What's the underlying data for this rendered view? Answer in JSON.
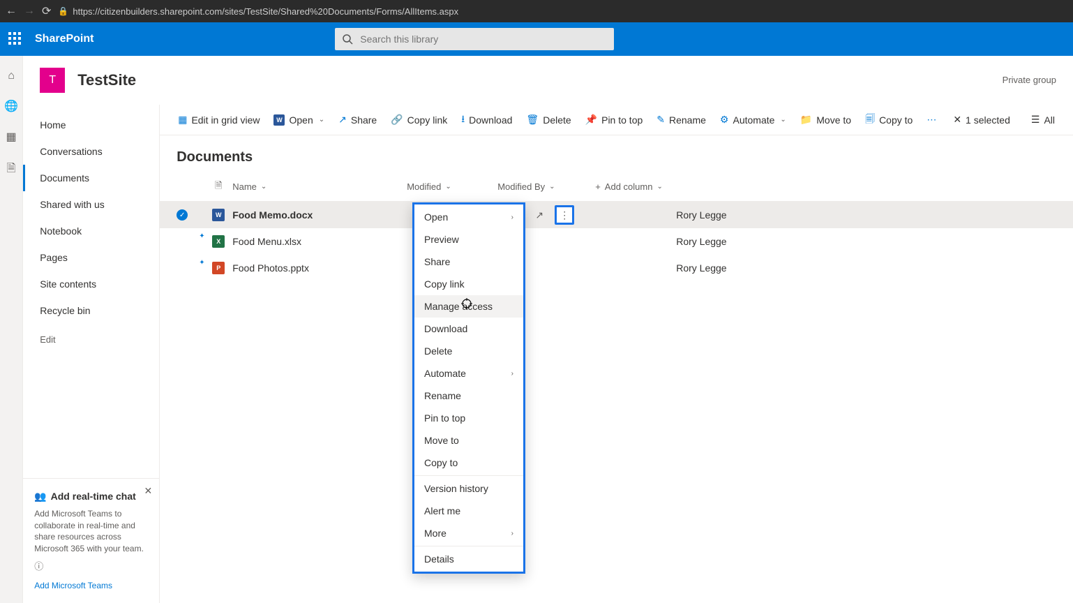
{
  "browser": {
    "url": "https://citizenbuilders.sharepoint.com/sites/TestSite/Shared%20Documents/Forms/AllItems.aspx"
  },
  "suite": {
    "app_name": "SharePoint",
    "search_placeholder": "Search this library"
  },
  "site": {
    "logo_letter": "T",
    "title": "TestSite",
    "privacy": "Private group"
  },
  "left_nav": {
    "items": [
      "Home",
      "Conversations",
      "Documents",
      "Shared with us",
      "Notebook",
      "Pages",
      "Site contents",
      "Recycle bin"
    ],
    "edit": "Edit"
  },
  "teams_promo": {
    "title": "Add real-time chat",
    "body": "Add Microsoft Teams to collaborate in real-time and share resources across Microsoft 365 with your team.",
    "link": "Add Microsoft Teams"
  },
  "cmdbar": {
    "edit_grid": "Edit in grid view",
    "open": "Open",
    "share": "Share",
    "copy_link": "Copy link",
    "download": "Download",
    "delete": "Delete",
    "pin": "Pin to top",
    "rename": "Rename",
    "automate": "Automate",
    "move_to": "Move to",
    "copy_to": "Copy to",
    "selected": "1 selected",
    "all": "All"
  },
  "list": {
    "title": "Documents",
    "columns": {
      "name": "Name",
      "modified": "Modified",
      "modified_by": "Modified By",
      "add": "Add column"
    },
    "rows": [
      {
        "name": "Food Memo.docx",
        "type": "word",
        "modified_by": "Rory Legge",
        "selected": true,
        "new": false
      },
      {
        "name": "Food Menu.xlsx",
        "type": "excel",
        "modified_by": "Rory Legge",
        "selected": false,
        "new": true
      },
      {
        "name": "Food Photos.pptx",
        "type": "ppt",
        "modified_by": "Rory Legge",
        "selected": false,
        "new": true
      }
    ]
  },
  "context_menu": {
    "open": "Open",
    "preview": "Preview",
    "share": "Share",
    "copy_link": "Copy link",
    "manage_access": "Manage access",
    "download": "Download",
    "delete": "Delete",
    "automate": "Automate",
    "rename": "Rename",
    "pin": "Pin to top",
    "move_to": "Move to",
    "copy_to": "Copy to",
    "version_history": "Version history",
    "alert_me": "Alert me",
    "more": "More",
    "details": "Details"
  }
}
